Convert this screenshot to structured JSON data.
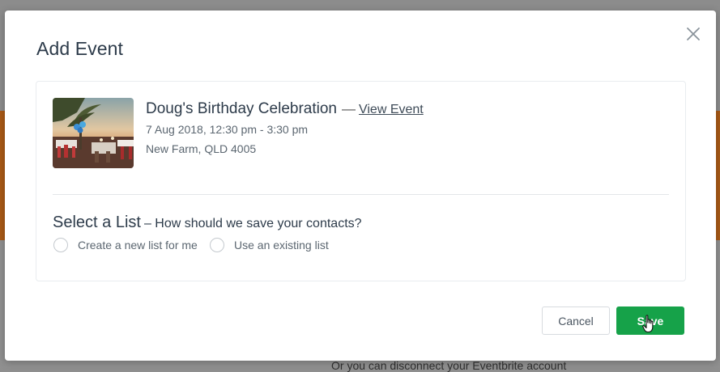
{
  "background": {
    "footer_text": "Or you can disconnect your Eventbrite account"
  },
  "modal": {
    "title": "Add Event",
    "close_icon": "close-icon"
  },
  "event": {
    "name": "Doug's Birthday Celebration",
    "separator": "—",
    "view_link": "View Event",
    "date": "7 Aug 2018, 12:30 pm - 3:30 pm",
    "location": "New Farm, QLD 4005",
    "thumbnail_icon": "event-photo"
  },
  "list_section": {
    "title": "Select a List",
    "subtitle": "– How should we save your contacts?",
    "options": [
      {
        "label": "Create a new list for me",
        "selected": false
      },
      {
        "label": "Use an existing list",
        "selected": false
      }
    ]
  },
  "actions": {
    "cancel_label": "Cancel",
    "save_label": "Save"
  },
  "colors": {
    "save_button": "#16a249",
    "title_text": "#2d3b4a",
    "backdrop_orange": "#a95a16"
  }
}
